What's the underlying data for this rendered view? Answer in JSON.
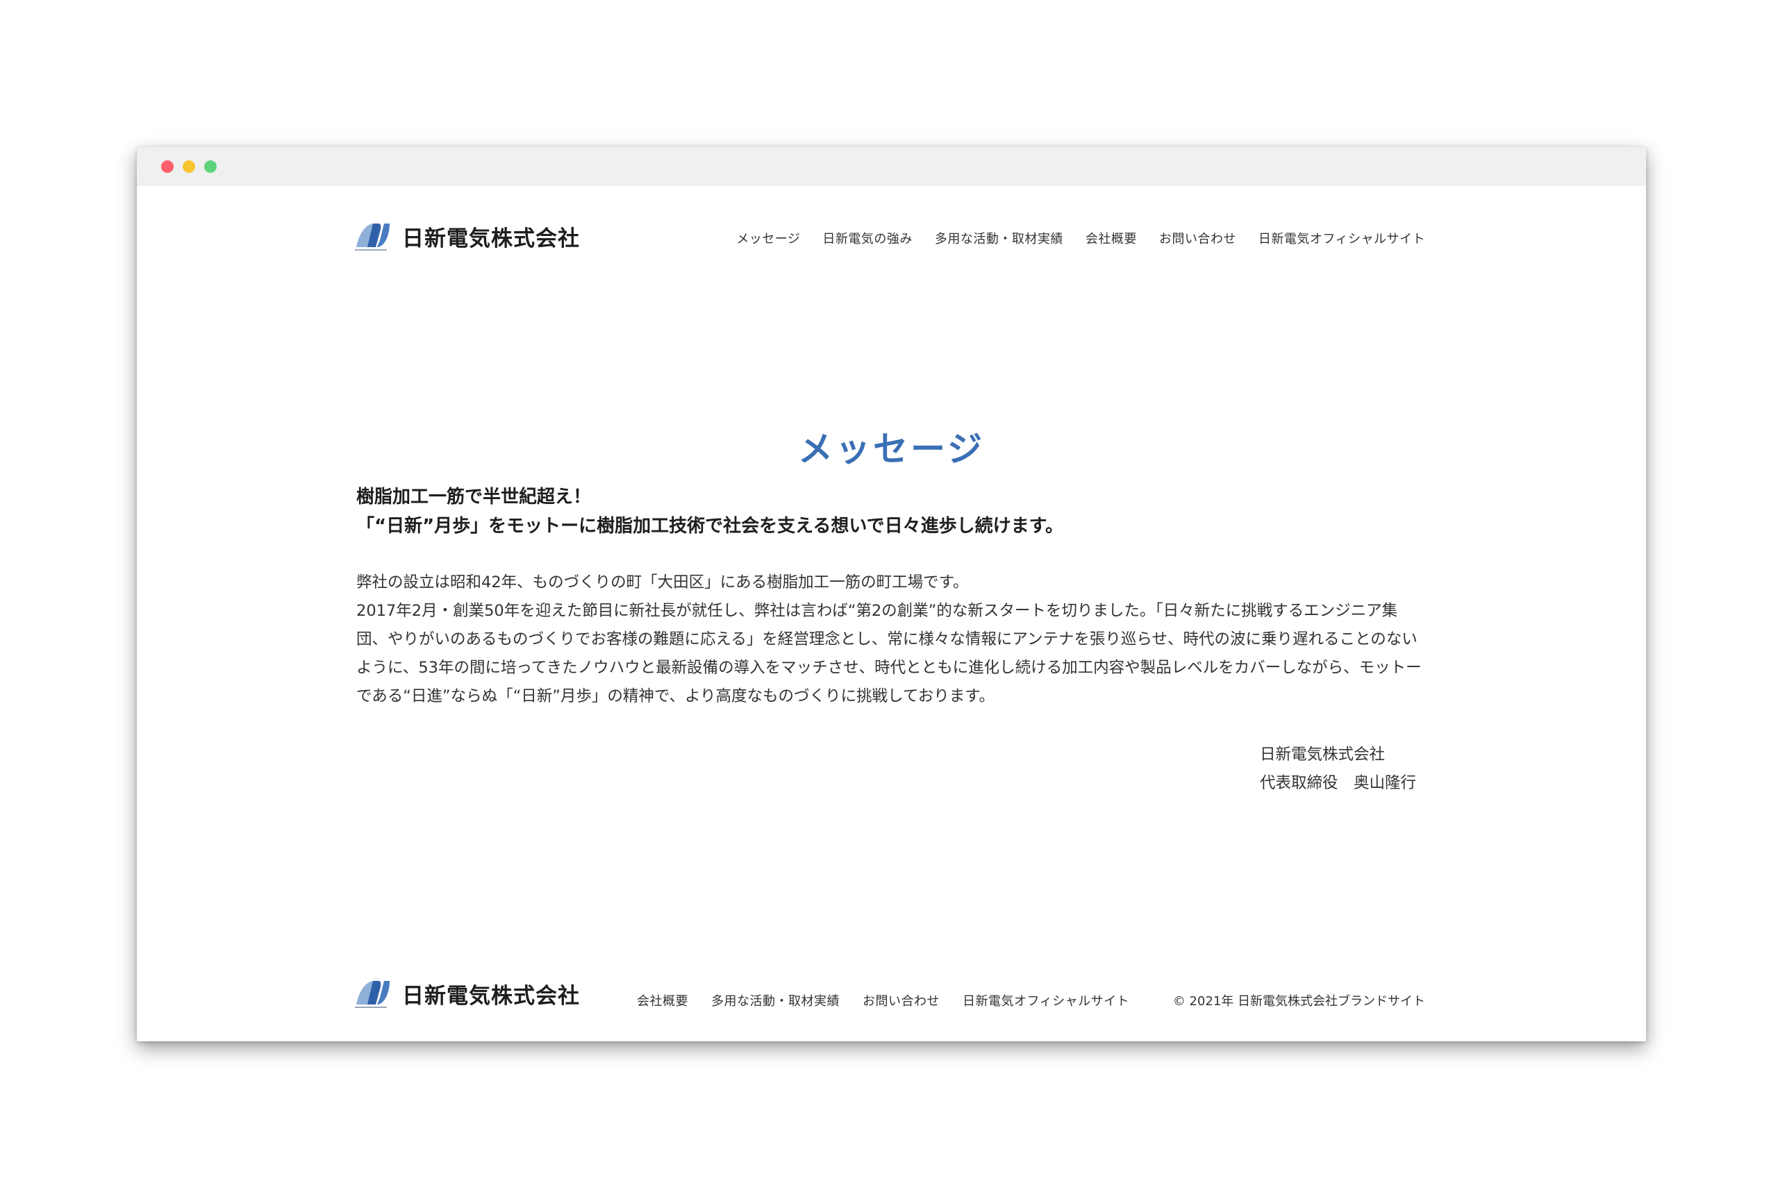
{
  "brand": {
    "name": "日新電気株式会社",
    "accent_color": "#3a6fb5"
  },
  "header": {
    "nav": [
      "メッセージ",
      "日新電気の強み",
      "多用な活動・取材実績",
      "会社概要",
      "お問い合わせ",
      "日新電気オフィシャルサイト"
    ]
  },
  "main": {
    "title": "メッセージ",
    "lead_line1": "樹脂加工一筋で半世紀超え！",
    "lead_line2": "「“日新”月歩」をモットーに樹脂加工技術で社会を支える想いで日々進歩し続けます。",
    "paragraph1": "弊社の設立は昭和42年、ものづくりの町「大田区」にある樹脂加工一筋の町工場です。",
    "paragraph2": "2017年2月・創業50年を迎えた節目に新社長が就任し、弊社は言わば“第2の創業”的な新スタートを切りました。「日々新たに挑戦するエンジニア集団、やりがいのあるものづくりでお客様の難題に応える」を経営理念とし、常に様々な情報にアンテナを張り巡らせ、時代の波に乗り遅れることのないように、53年の間に培ってきたノウハウと最新設備の導入をマッチさせ、時代とともに進化し続ける加工内容や製品レベルをカバーしながら、モットーである“日進”ならぬ「“日新”月歩」の精神で、より高度なものづくりに挑戦しております。",
    "signature_company": "日新電気株式会社",
    "signature_person": "代表取締役　奥山隆行"
  },
  "footer": {
    "nav": [
      "会社概要",
      "多用な活動・取材実績",
      "お問い合わせ",
      "日新電気オフィシャルサイト"
    ],
    "copyright": "© 2021年 日新電気株式会社ブランドサイト"
  }
}
